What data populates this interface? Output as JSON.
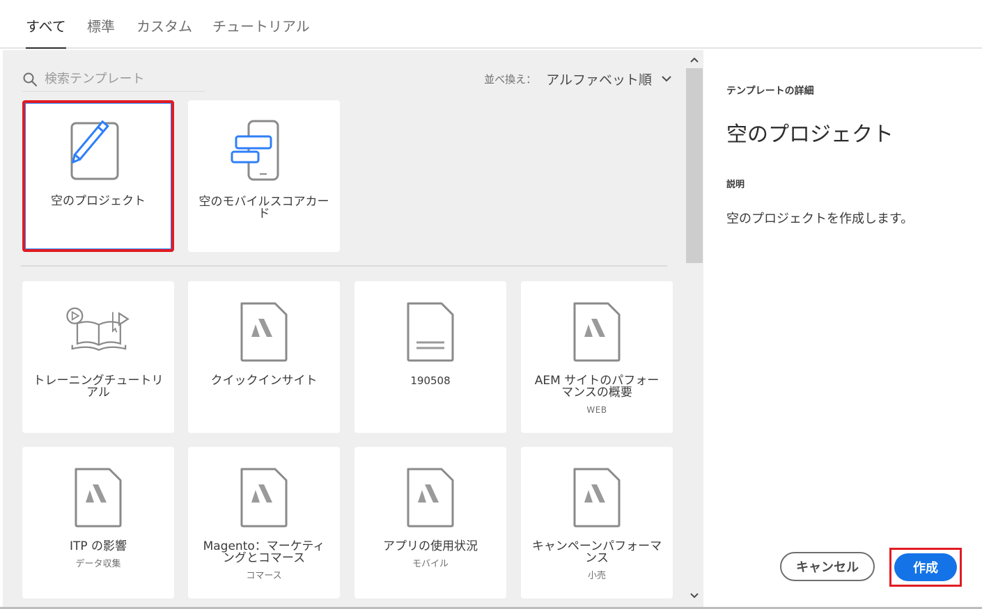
{
  "tabs": [
    {
      "label": "すべて"
    },
    {
      "label": "標準"
    },
    {
      "label": "カスタム"
    },
    {
      "label": "チュートリアル"
    }
  ],
  "search": {
    "placeholder": "検索テンプレート"
  },
  "sort": {
    "label": "並べ換え：",
    "value": "アルファベット順"
  },
  "featured": [
    {
      "title": "空のプロジェクト",
      "icon": "blank-project-icon"
    },
    {
      "title": "空のモバイルスコアカード",
      "icon": "mobile-scorecard-icon"
    }
  ],
  "templates": [
    {
      "title": "トレーニングチュートリアル",
      "sub": "",
      "icon": "training-book-icon"
    },
    {
      "title": "クイックインサイト",
      "sub": "",
      "icon": "adobe-doc-icon"
    },
    {
      "title": "190508",
      "sub": "",
      "icon": "doc-icon"
    },
    {
      "title": "AEM サイトのパフォーマンスの概要",
      "sub": "WEB",
      "icon": "adobe-doc-icon"
    },
    {
      "title": "ITP の影響",
      "sub": "データ収集",
      "icon": "adobe-doc-icon"
    },
    {
      "title": "Magento：マーケティングとコマース",
      "sub": "コマース",
      "icon": "adobe-doc-icon"
    },
    {
      "title": "アプリの使用状況",
      "sub": "モバイル",
      "icon": "adobe-doc-icon"
    },
    {
      "title": "キャンペーンパフォーマンス",
      "sub": "小売",
      "icon": "adobe-doc-icon"
    }
  ],
  "detail": {
    "heading": "テンプレートの詳細",
    "title": "空のプロジェクト",
    "desc_label": "説明",
    "desc": "空のプロジェクトを作成します。"
  },
  "actions": {
    "cancel": "キャンセル",
    "create": "作成"
  },
  "colors": {
    "primary": "#1473e6",
    "highlight": "#e11b22",
    "icon_blue": "#2d7ff9"
  }
}
